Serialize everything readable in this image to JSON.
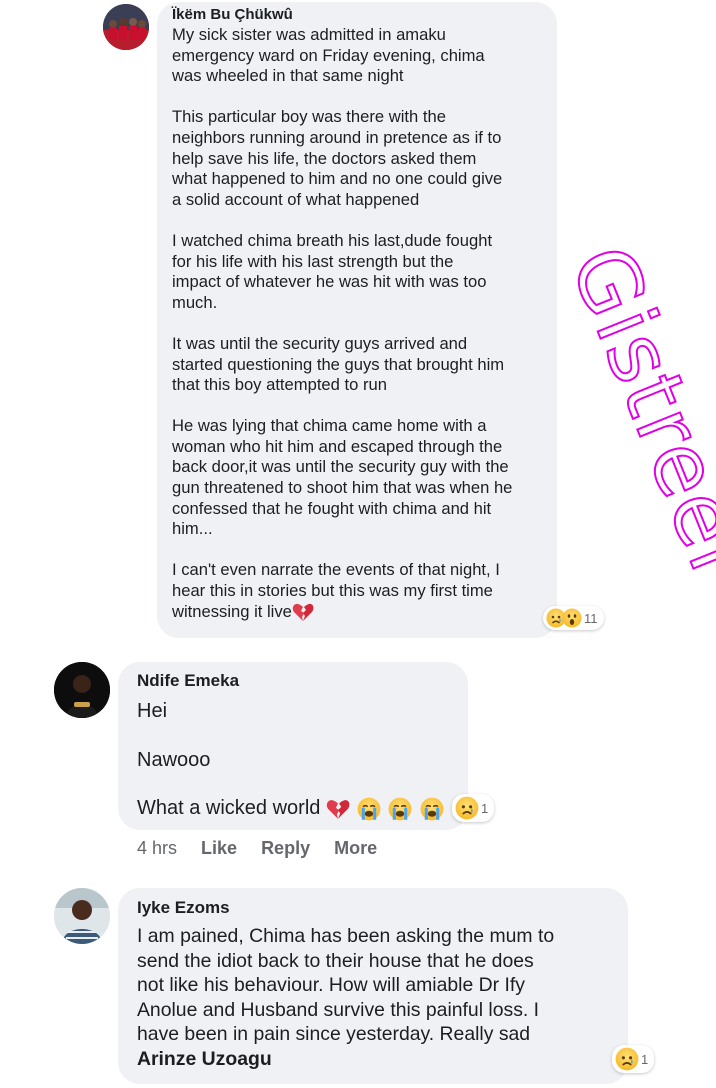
{
  "comments": [
    {
      "author": "Ïkëm Bu Çhükwû",
      "paragraphs": [
        "My sick sister was admitted in amaku\nemergency ward on Friday evening, chima\nwas wheeled in that same night",
        "This particular boy was there with the\nneighbors running around in pretence as if to\nhelp save his life, the doctors asked them\nwhat happened to him and no one could give\na solid account of what happened",
        "I watched chima breath his last,dude fought\nfor his life with his last strength but the\nimpact of whatever he was hit with was too\nmuch.",
        "It was until the security guys arrived and\nstarted questioning the guys that brought him\nthat this boy attempted to run",
        "He was lying that chima came home with a\nwoman who hit him and escaped through the\nback door,it was until the security guy with the\ngun threatened to shoot him that was when he\nconfessed that he fought with chima and hit\nhim...",
        "I can't even narrate the events of that night, I\nhear this in stories but this was my first time\nwitnessing it live"
      ],
      "reactions": [
        "sad-face-icon",
        "wow-face-icon"
      ],
      "reaction_count": "11"
    },
    {
      "author": "Ndife Emeka",
      "paragraphs": [
        "Hei",
        "Nawooo",
        "What a wicked world"
      ],
      "reactions": [
        "sad-face-icon"
      ],
      "reaction_count": "1",
      "time": "4 hrs",
      "like": "Like",
      "reply": "Reply",
      "more": "More"
    },
    {
      "author": "Iyke Ezoms",
      "text": "I am pained, Chima has been asking the mum to\nsend the idiot back to their house that he does\nnot like his behaviour. How will amiable Dr Ify\nAnolue and Husband survive this painful loss. I\nhave been in pain since yesterday. Really sad",
      "tag": "Arinze Uzoagu",
      "reactions": [
        "sad-face-icon"
      ],
      "reaction_count": "1"
    }
  ],
  "watermark": "Gistreel",
  "colors": {
    "bubble": "#eff1f4",
    "watermark": "#e000e8",
    "meta": "#65676b"
  }
}
